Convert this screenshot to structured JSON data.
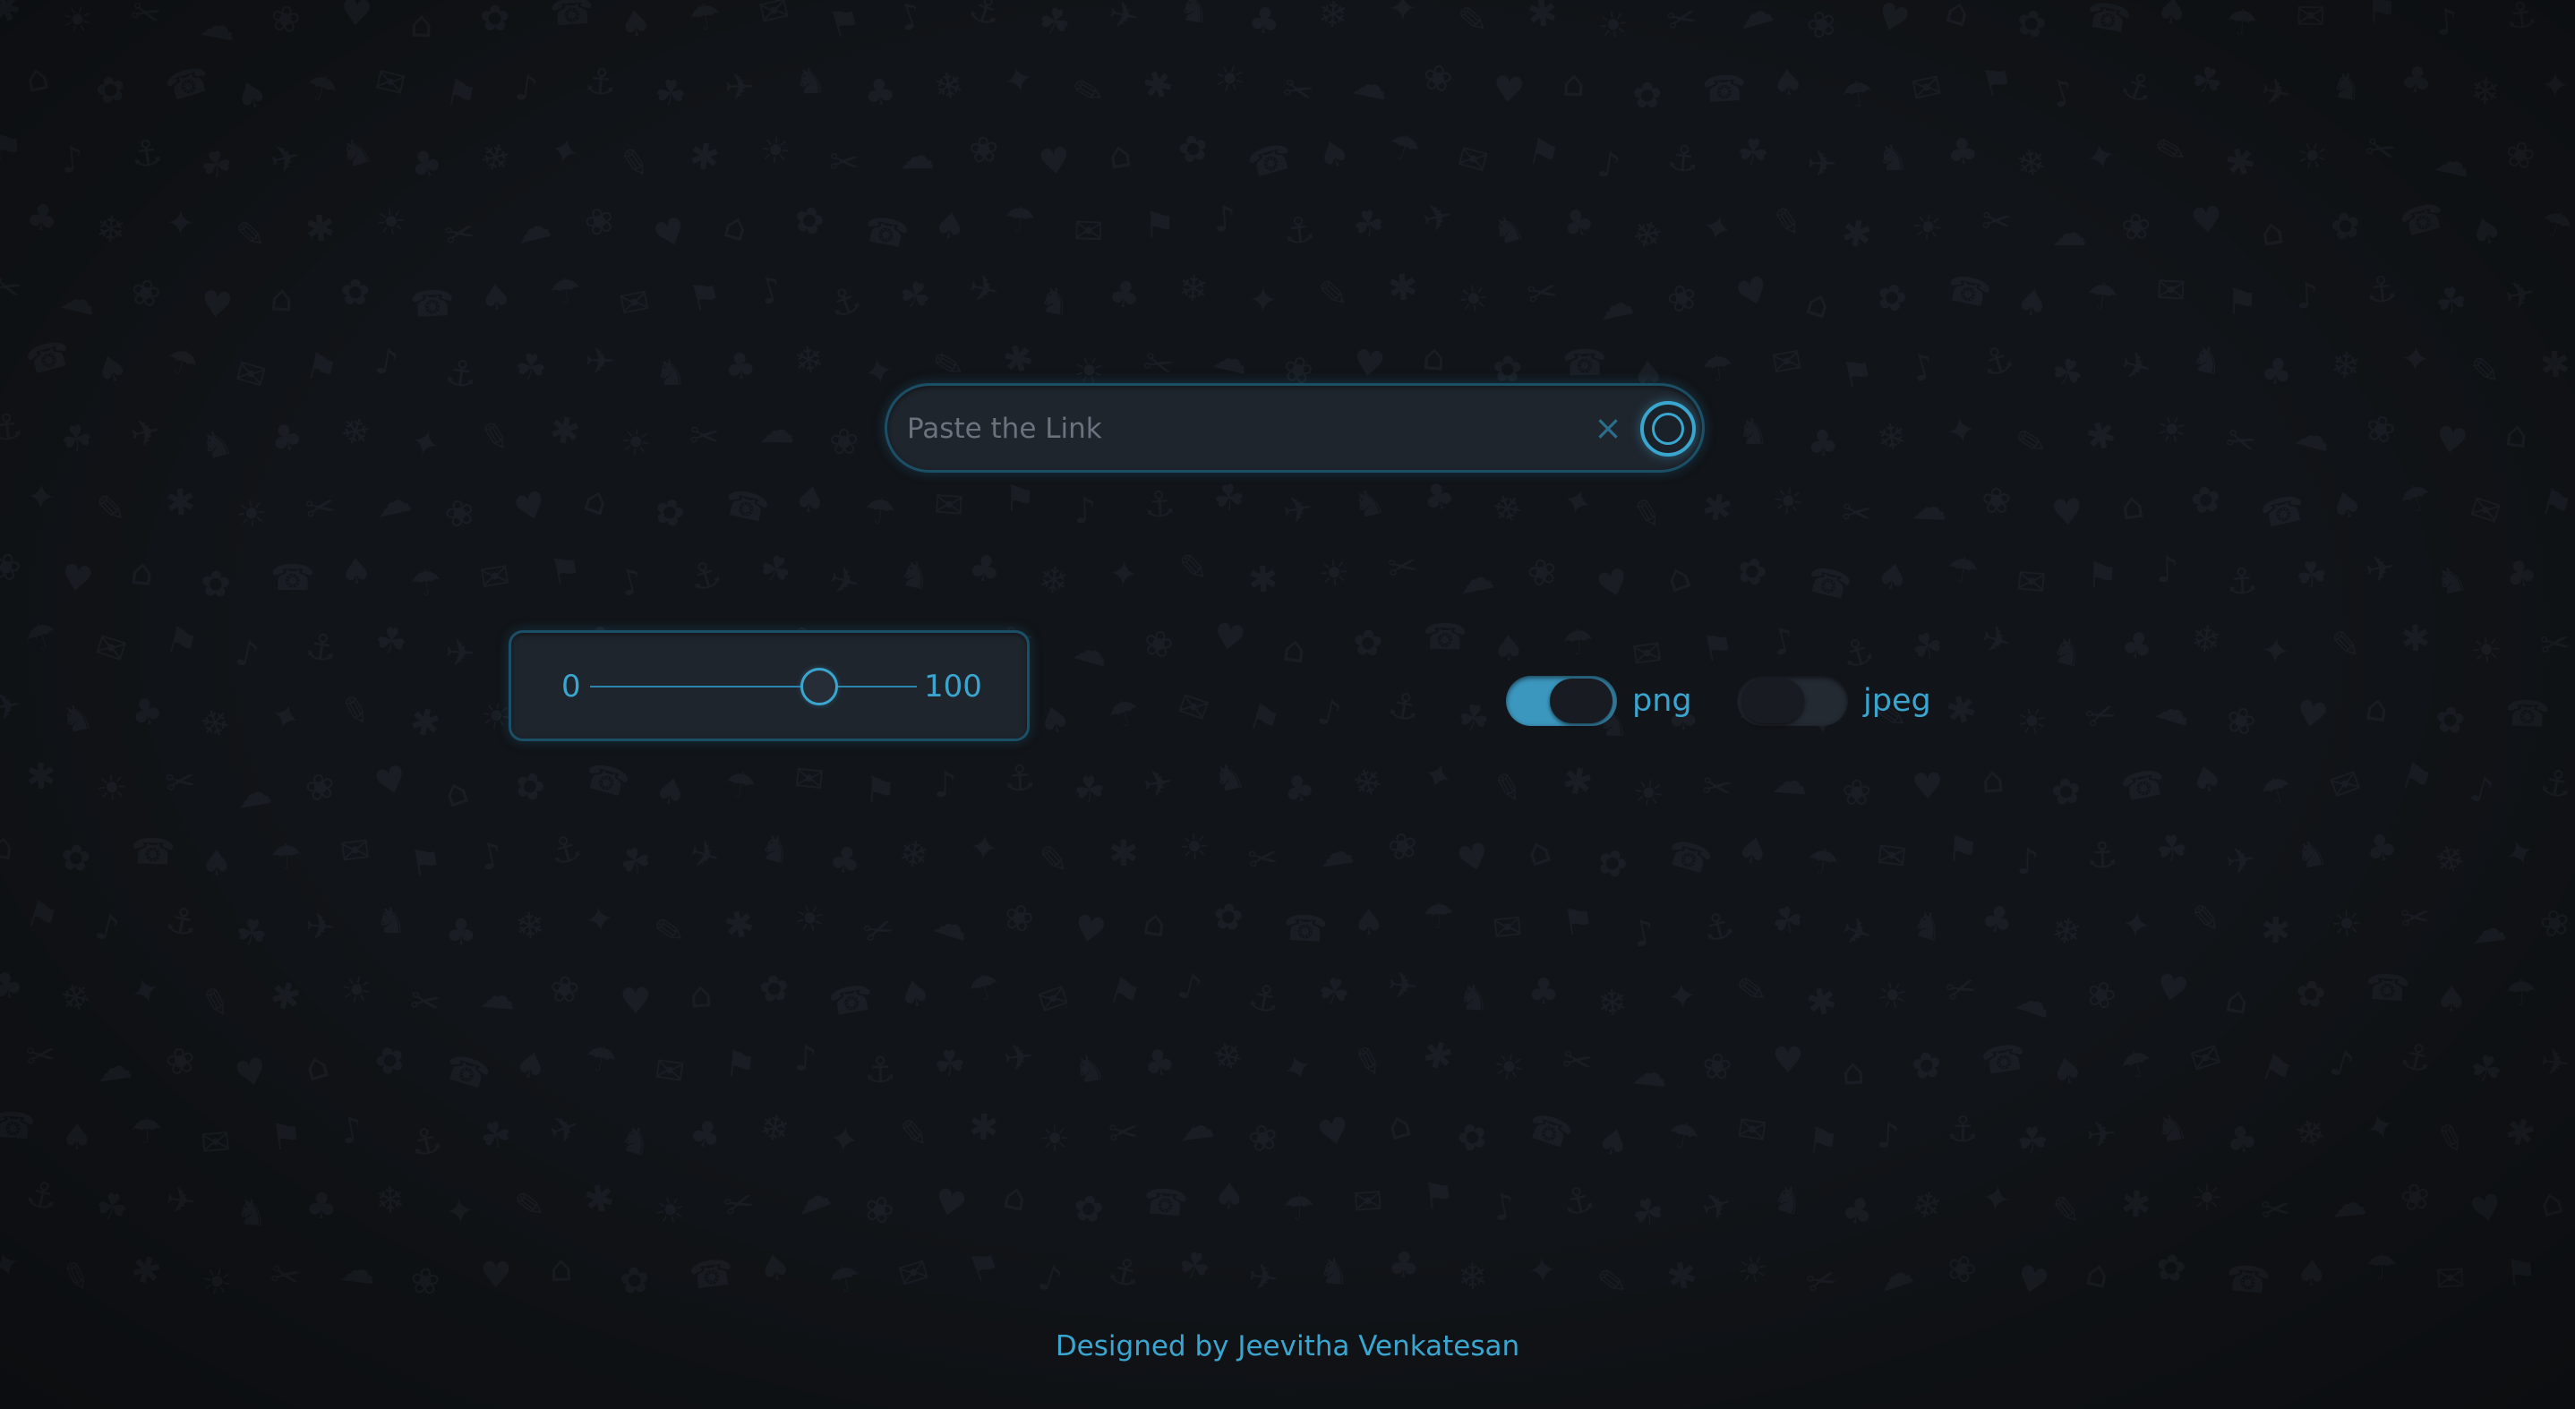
{
  "background": {
    "pattern_icons": [
      "apple-icon",
      "bitcoin-icon",
      "rocket-icon",
      "snowflake-icon",
      "cloud-icon",
      "car-icon",
      "bell-icon",
      "bicycle-icon",
      "gift-icon",
      "twitter-icon",
      "anchor-icon",
      "diamond-icon"
    ],
    "color": "#111418"
  },
  "search": {
    "placeholder": "Paste the Link",
    "value": ""
  },
  "quality_slider": {
    "min_label": "0",
    "max_label": "100",
    "value_fraction": 0.7
  },
  "formats": [
    {
      "label": "png",
      "enabled": true
    },
    {
      "label": "jpeg",
      "enabled": false
    }
  ],
  "footer": {
    "credit": "Designed by Jeevitha Venkatesan"
  },
  "colors": {
    "accent": "#3aa6cf",
    "panel": "#1f252d",
    "border": "#1b4f66"
  }
}
